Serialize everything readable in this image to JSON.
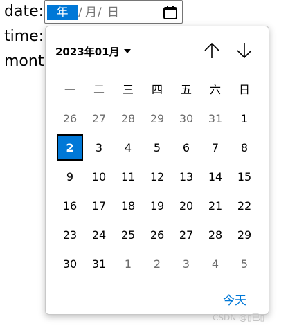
{
  "form": {
    "date_label": "date:",
    "time_label": "time:",
    "month_label": "mont"
  },
  "date_input": {
    "year_placeholder": "年",
    "month_placeholder": "月",
    "day_placeholder": "日",
    "separator": "/",
    "calendar_icon": "calendar-icon"
  },
  "picker": {
    "month_year": "2023年01月",
    "dropdown_icon": "caret-down-icon",
    "prev_icon": "arrow-up-icon",
    "next_icon": "arrow-down-icon",
    "weekdays": [
      "一",
      "二",
      "三",
      "四",
      "五",
      "六",
      "日"
    ],
    "weeks": [
      [
        {
          "d": "26",
          "o": true
        },
        {
          "d": "27",
          "o": true
        },
        {
          "d": "28",
          "o": true
        },
        {
          "d": "29",
          "o": true
        },
        {
          "d": "30",
          "o": true
        },
        {
          "d": "31",
          "o": true
        },
        {
          "d": "1",
          "o": false
        }
      ],
      [
        {
          "d": "2",
          "o": false,
          "sel": true
        },
        {
          "d": "3",
          "o": false
        },
        {
          "d": "4",
          "o": false
        },
        {
          "d": "5",
          "o": false
        },
        {
          "d": "6",
          "o": false
        },
        {
          "d": "7",
          "o": false
        },
        {
          "d": "8",
          "o": false
        }
      ],
      [
        {
          "d": "9",
          "o": false
        },
        {
          "d": "10",
          "o": false
        },
        {
          "d": "11",
          "o": false
        },
        {
          "d": "12",
          "o": false
        },
        {
          "d": "13",
          "o": false
        },
        {
          "d": "14",
          "o": false
        },
        {
          "d": "15",
          "o": false
        }
      ],
      [
        {
          "d": "16",
          "o": false
        },
        {
          "d": "17",
          "o": false
        },
        {
          "d": "18",
          "o": false
        },
        {
          "d": "19",
          "o": false
        },
        {
          "d": "20",
          "o": false
        },
        {
          "d": "21",
          "o": false
        },
        {
          "d": "22",
          "o": false
        }
      ],
      [
        {
          "d": "23",
          "o": false
        },
        {
          "d": "24",
          "o": false
        },
        {
          "d": "25",
          "o": false
        },
        {
          "d": "26",
          "o": false
        },
        {
          "d": "27",
          "o": false
        },
        {
          "d": "28",
          "o": false
        },
        {
          "d": "29",
          "o": false
        }
      ],
      [
        {
          "d": "30",
          "o": false
        },
        {
          "d": "31",
          "o": false
        },
        {
          "d": "1",
          "o": true
        },
        {
          "d": "2",
          "o": true
        },
        {
          "d": "3",
          "o": true
        },
        {
          "d": "4",
          "o": true
        },
        {
          "d": "5",
          "o": true
        }
      ]
    ],
    "today_label": "今天"
  },
  "watermark": "CSDN @▯已▯",
  "colors": {
    "accent": "#0078d7",
    "other_month": "#6d6d6d"
  }
}
